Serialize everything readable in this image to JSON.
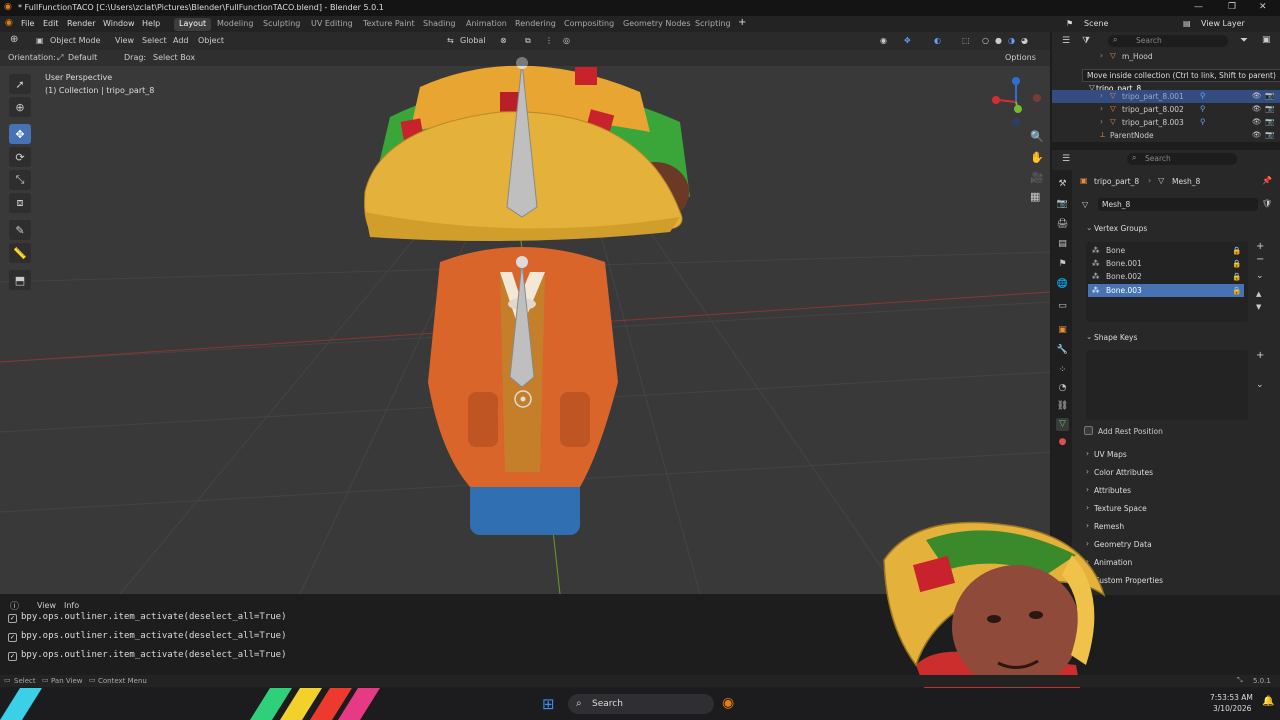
{
  "window": {
    "title": "* FullFunctionTACO [C:\\Users\\zclat\\Pictures\\Blender\\FullFunctionTACO.blend] - Blender 5.0.1",
    "minimize": "—",
    "maximize": "❐",
    "close": "✕"
  },
  "menu": {
    "items": [
      "File",
      "Edit",
      "Render",
      "Window",
      "Help"
    ],
    "workspaces": [
      "Layout",
      "Modeling",
      "Sculpting",
      "UV Editing",
      "Texture Paint",
      "Shading",
      "Animation",
      "Rendering",
      "Compositing",
      "Geometry Nodes",
      "Scripting"
    ],
    "add_workspace": "+",
    "scene_label": "Scene",
    "view_layer_label": "View Layer"
  },
  "viewport": {
    "mode": "Object Mode",
    "menu": [
      "View",
      "Select",
      "Add",
      "Object"
    ],
    "transform_orientation": "Global",
    "orientation_label": "Orientation:",
    "orientation_value": "Default",
    "drag_label": "Drag:",
    "drag_value": "Select Box",
    "options_label": "Options",
    "overlay_title": "User Perspective",
    "overlay_subtitle": "(1) Collection | tripo_part_8"
  },
  "outliner": {
    "search_placeholder": "Search",
    "rows": [
      "m_Hood",
      "tripo_part_8",
      "tripo_part_8.001",
      "tripo_part_8.002",
      "tripo_part_8.003",
      "ParentNode"
    ],
    "tooltip": "Move inside collection (Ctrl to link, Shift to parent)"
  },
  "properties": {
    "search_placeholder": "Search",
    "breadcrumb_object": "tripo_part_8",
    "breadcrumb_mesh": "Mesh_8",
    "mesh_name": "Mesh_8",
    "vertex_groups_title": "Vertex Groups",
    "vertex_groups": [
      "Bone",
      "Bone.001",
      "Bone.002",
      "Bone.003"
    ],
    "shape_keys_title": "Shape Keys",
    "add_rest_position": "Add Rest Position",
    "sections": [
      "UV Maps",
      "Color Attributes",
      "Attributes",
      "Texture Space",
      "Remesh",
      "Geometry Data",
      "Animation",
      "Custom Properties"
    ]
  },
  "console": {
    "menu": [
      "View",
      "Info"
    ],
    "lines": [
      "bpy.ops.outliner.item_activate(deselect_all=True)",
      "bpy.ops.outliner.item_activate(deselect_all=True)",
      "bpy.ops.outliner.item_activate(deselect_all=True)"
    ]
  },
  "statusbar": {
    "select": "Select",
    "pan_view": "Pan View",
    "context_menu": "Context Menu",
    "version": "5.0.1"
  },
  "taskbar": {
    "search": "Search",
    "time": "7:53:53 AM",
    "date": "3/10/2026"
  },
  "colors": {
    "accent": "#4772b3",
    "taco_shell": "#e4b23a",
    "jacket": "#d9652a",
    "jeans": "#2f6fb2",
    "lettuce": "#3aa63a",
    "tomato": "#c8232c"
  }
}
